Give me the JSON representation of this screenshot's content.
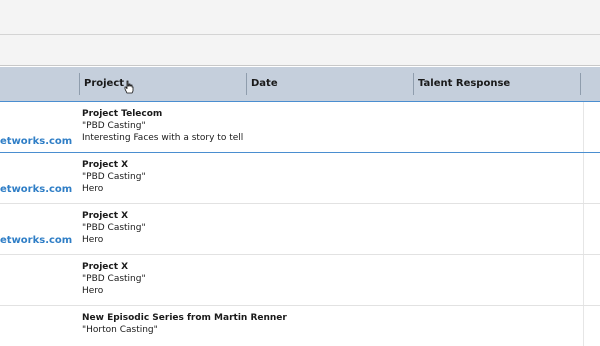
{
  "table": {
    "columns": [
      "Project",
      "Date",
      "Talent Response"
    ],
    "rows": [
      {
        "email": "etworks.com",
        "project_title": "Project Telecom",
        "casting": "\"PBD Casting\"",
        "role": "Interesting Faces with a story to tell"
      },
      {
        "email": "etworks.com",
        "project_title": "Project X",
        "casting": "\"PBD Casting\"",
        "role": "Hero"
      },
      {
        "email": "etworks.com",
        "project_title": "Project X",
        "casting": "\"PBD Casting\"",
        "role": "Hero"
      },
      {
        "email": "",
        "project_title": "Project X",
        "casting": "\"PBD Casting\"",
        "role": "Hero"
      },
      {
        "email": "",
        "project_title": "New Episodic Series from Martin Renner",
        "casting": "\"Horton Casting\"",
        "role": ""
      }
    ]
  },
  "icons": {
    "cursor": "hand-pointer-icon"
  }
}
